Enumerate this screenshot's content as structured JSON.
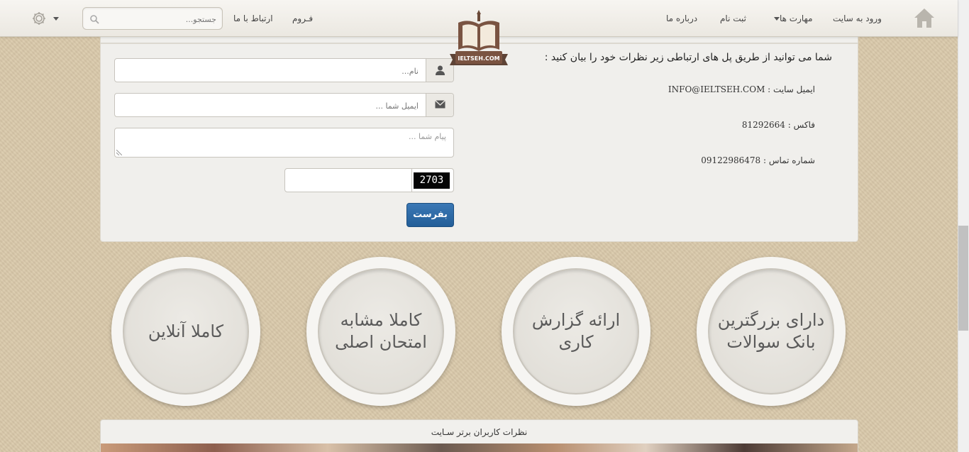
{
  "nav": {
    "home_icon": "home-icon",
    "login": "ورود به سایت",
    "skills": "مهارت ها",
    "register": "ثبت نام",
    "about": "درباره ما",
    "forum": "فـروم",
    "contact": "ارتباط با ما",
    "search_placeholder": "جستجو...",
    "settings_icon": "gear-icon"
  },
  "logo": {
    "text": "IELTSEH.COM"
  },
  "contact": {
    "intro": "شما می توانید از طریق پل های ارتباطی زیر نظرات خود را بیان کنید :",
    "email": "ایمیل سایت : INFO@IELTSEH.COM",
    "fax": "فاکس : 81292664",
    "phone": "شماره تماس : 09122986478",
    "name_placeholder": "نام...",
    "email_placeholder": "ایمیل شما ...",
    "message_placeholder": "پیام شما ...",
    "captcha_code": "2703",
    "submit_label": "بفرست"
  },
  "features": [
    {
      "label": "دارای بزرگترین بانک سوالات"
    },
    {
      "label": "ارائه گزارش کاری"
    },
    {
      "label": "کاملا مشابه امتحان اصلی"
    },
    {
      "label": "کاملا آنلاین"
    }
  ],
  "testimonials": {
    "title": "نظرات کاربران برتر سـایت"
  },
  "colors": {
    "accent": "#2f6ca8",
    "background": "#d9c8a9",
    "panel": "#f0efec"
  }
}
